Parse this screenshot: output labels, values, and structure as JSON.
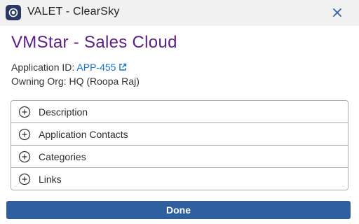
{
  "header": {
    "title": "VALET - ClearSky",
    "logo_icon": "circle-logo-icon",
    "close_icon": "close-icon"
  },
  "page": {
    "title": "VMStar - Sales Cloud"
  },
  "details": {
    "app_id_label": "Application ID:",
    "app_id_value": "APP-455",
    "app_id_icon": "external-link-icon",
    "org_label": "Owning Org:",
    "org_value": "HQ (Roopa Raj)"
  },
  "sections": [
    {
      "label": "Description",
      "icon": "plus-circle-icon"
    },
    {
      "label": "Application Contacts",
      "icon": "plus-circle-icon"
    },
    {
      "label": "Categories",
      "icon": "plus-circle-icon"
    },
    {
      "label": "Links",
      "icon": "plus-circle-icon"
    }
  ],
  "footer": {
    "done_label": "Done"
  },
  "colors": {
    "title": "#5a1f86",
    "link": "#1a73c9",
    "button": "#2f5f9e",
    "logo_bg": "#283a63"
  }
}
